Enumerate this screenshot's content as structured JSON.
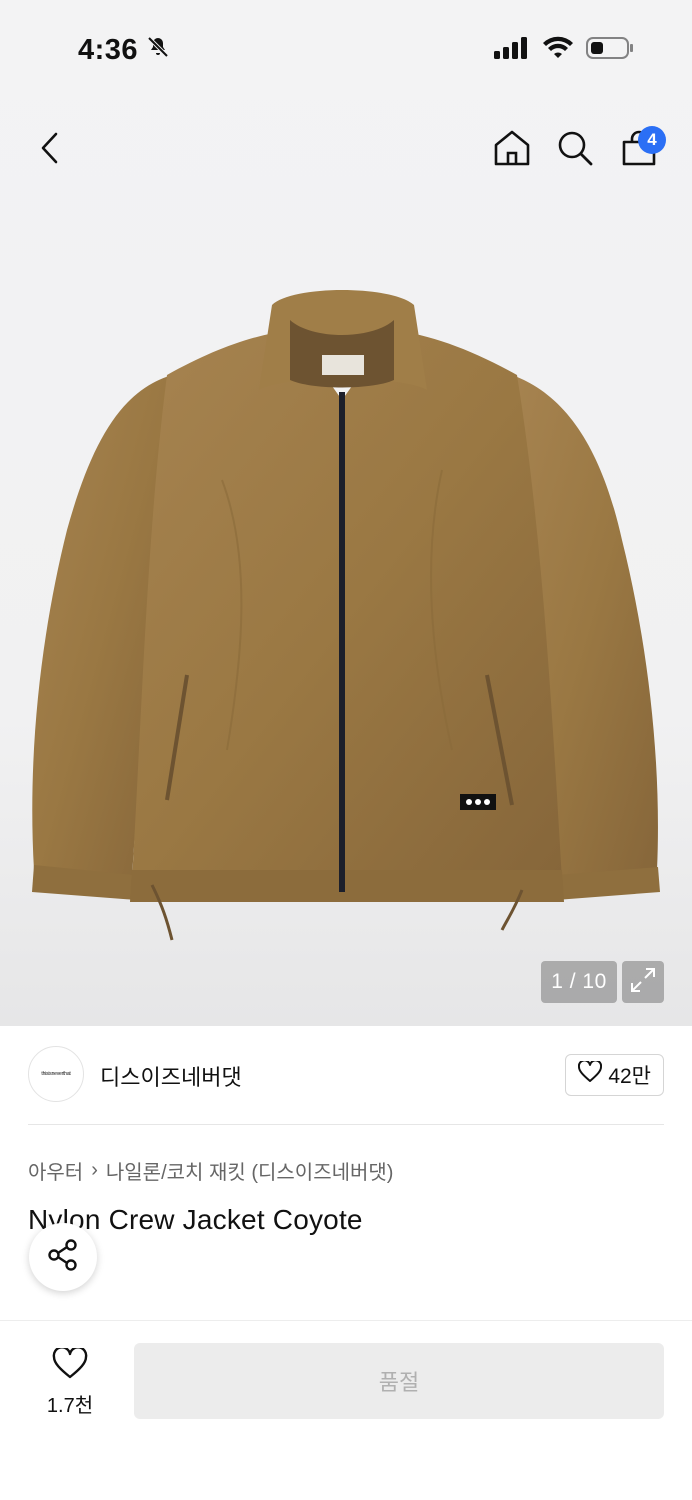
{
  "status_bar": {
    "time": "4:36"
  },
  "header": {
    "cart_count": "4"
  },
  "gallery": {
    "counter": "1 / 10"
  },
  "brand": {
    "logo_text": "thisisneverthat",
    "name": "디스이즈네버댓",
    "like_count": "42만"
  },
  "breadcrumb": {
    "category": "아우터",
    "separator": "›",
    "subcategory": "나일론/코치 재킷 (디스이즈네버댓)"
  },
  "product": {
    "title": "Nylon Crew Jacket Coyote"
  },
  "bottom_bar": {
    "wish_count": "1.7천",
    "buy_label": "품절"
  },
  "colors": {
    "accent": "#2b6ff5",
    "jacket": "#9c7a45",
    "disabled_bg": "#ececec",
    "disabled_text": "#b0b0b0"
  },
  "icons": [
    "bell-off-icon",
    "signal-icon",
    "wifi-icon",
    "battery-icon",
    "back-arrow-icon",
    "home-icon",
    "search-icon",
    "shopping-bag-icon",
    "expand-icon",
    "heart-icon",
    "share-icon"
  ]
}
